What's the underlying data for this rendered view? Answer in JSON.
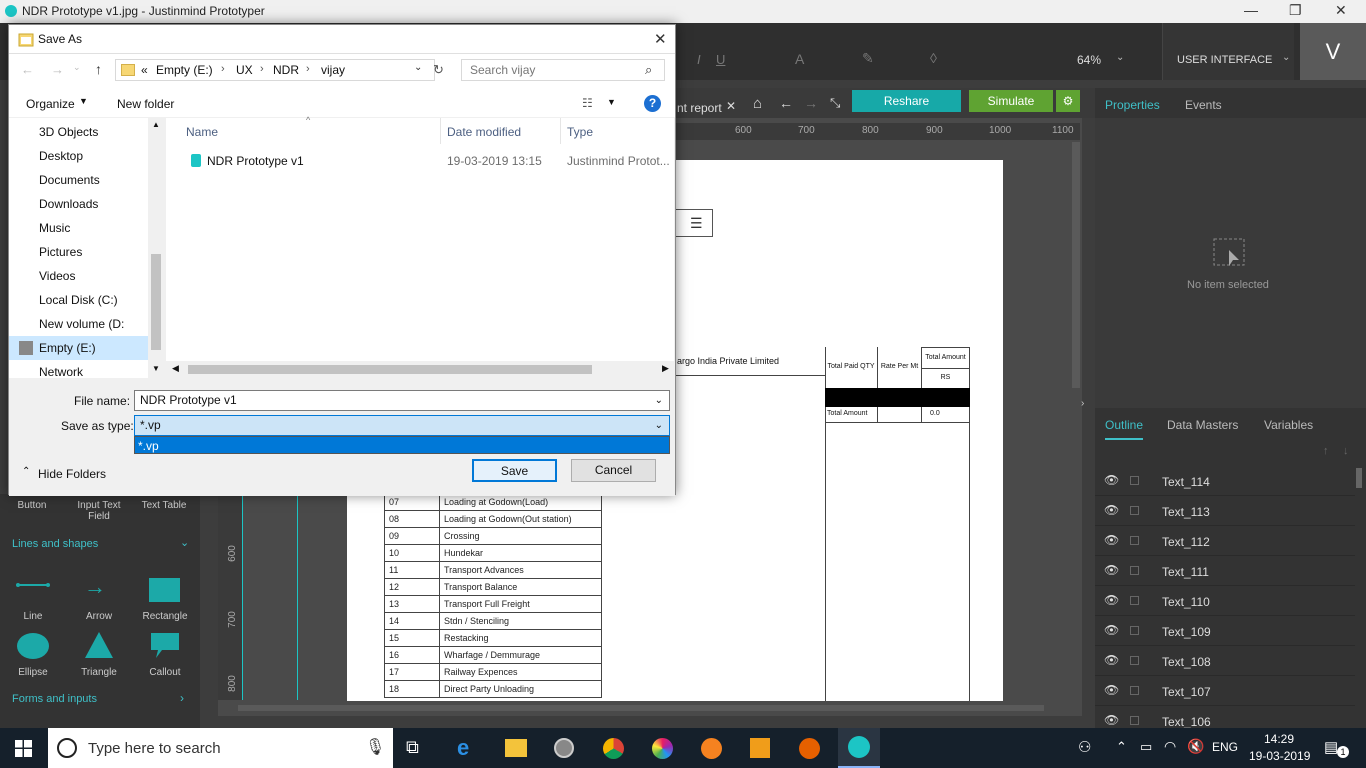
{
  "app": {
    "title": "NDR Prototype v1.jpg - Justinmind Prototyper"
  },
  "toolbar": {
    "zoom": "64%",
    "perspective": "USER INTERFACE",
    "user_initial": "V"
  },
  "toolbar2": {
    "tab_label": "nt report",
    "reshare": "Reshare",
    "simulate": "Simulate"
  },
  "ruler": {
    "ticks": [
      "600",
      "700",
      "800",
      "900",
      "1000",
      "1100"
    ]
  },
  "vruler": {
    "ticks": [
      "600",
      "700",
      "800"
    ]
  },
  "canvas": {
    "company_fragment": "argo India Private Limited",
    "col_total_paid_qty": "Total Paid QTY",
    "col_rate_per_mt": "Rate Per Mt",
    "col_total_amount": "Total Amount",
    "col_rs": "RS",
    "total_amount_label": "Total Amount",
    "total_amount_value": "0.0",
    "rows": [
      {
        "no": "07",
        "label": "Loading at Godown(Load)"
      },
      {
        "no": "08",
        "label": "Loading at Godown(Out station)"
      },
      {
        "no": "09",
        "label": "Crossing"
      },
      {
        "no": "10",
        "label": "Hundekar"
      },
      {
        "no": "11",
        "label": "Transport Advances"
      },
      {
        "no": "12",
        "label": "Transport Balance"
      },
      {
        "no": "13",
        "label": "Transport Full Freight"
      },
      {
        "no": "14",
        "label": "Stdn / Stenciling"
      },
      {
        "no": "15",
        "label": "Restacking"
      },
      {
        "no": "16",
        "label": "Wharfage / Demmurage"
      },
      {
        "no": "17",
        "label": "Railway Expences"
      },
      {
        "no": "18",
        "label": "Direct Party Unloading"
      }
    ]
  },
  "right_panel": {
    "tabs": [
      "Properties",
      "Events"
    ],
    "empty_text": "No item selected",
    "lower_tabs": [
      "Outline",
      "Data Masters",
      "Variables"
    ],
    "outline": [
      "Text_114",
      "Text_113",
      "Text_112",
      "Text_111",
      "Text_110",
      "Text_109",
      "Text_108",
      "Text_107",
      "Text_106"
    ]
  },
  "left_panel": {
    "widgets_top": [
      "Button",
      "Input Text Field",
      "Text Table"
    ],
    "section_lines": "Lines and shapes",
    "shapes": [
      "Line",
      "Arrow",
      "Rectangle",
      "Ellipse",
      "Triangle",
      "Callout"
    ],
    "section_forms": "Forms and inputs"
  },
  "dialog": {
    "title": "Save As",
    "breadcrumb": [
      "«",
      "Empty  (E:)",
      "UX",
      "NDR",
      "vijay"
    ],
    "search_placeholder": "Search vijay",
    "organize": "Organize",
    "new_folder": "New folder",
    "tree": [
      "3D Objects",
      "Desktop",
      "Documents",
      "Downloads",
      "Music",
      "Pictures",
      "Videos",
      "Local Disk (C:)",
      "New volume (D:",
      "Empty  (E:)",
      "Network"
    ],
    "columns": [
      "Name",
      "Date modified",
      "Type"
    ],
    "files": [
      {
        "name": "NDR Prototype v1",
        "date": "19-03-2019 13:15",
        "type": "Justinmind Protot..."
      }
    ],
    "file_name_label": "File name:",
    "file_name_value": "NDR Prototype v1",
    "save_as_type_label": "Save as type:",
    "save_as_type_value": "*.vp",
    "dropdown_option": "*.vp",
    "hide_folders": "Hide Folders",
    "save": "Save",
    "cancel": "Cancel"
  },
  "taskbar": {
    "search_placeholder": "Type here to search",
    "lang": "ENG",
    "time": "14:29",
    "date": "19-03-2019",
    "notif_count": "1"
  },
  "colors": {
    "accent_teal": "#17a9a8",
    "simulate_green": "#5fa332",
    "selection_blue": "#0078d7"
  }
}
